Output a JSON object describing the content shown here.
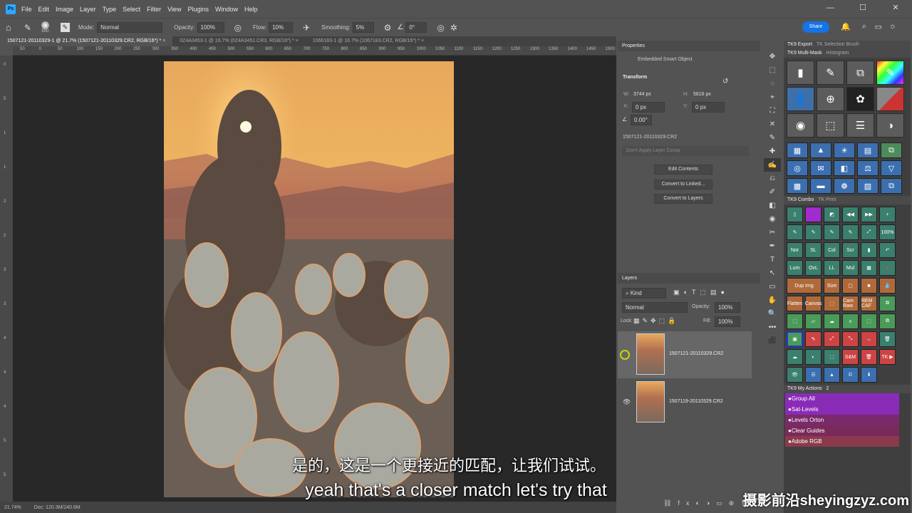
{
  "menu": {
    "logo": "Ps",
    "items": [
      "File",
      "Edit",
      "Image",
      "Layer",
      "Type",
      "Select",
      "Filter",
      "View",
      "Plugins",
      "Window",
      "Help"
    ]
  },
  "window_controls": [
    "—",
    "☐",
    "✕"
  ],
  "options": {
    "brush_size": "500",
    "mode_label": "Mode:",
    "mode_value": "Normal",
    "opacity_label": "Opacity:",
    "opacity_value": "100%",
    "flow_label": "Flow:",
    "flow_value": "10%",
    "smoothing_label": "Smoothing:",
    "smoothing_value": "5%",
    "angle_value": "0°",
    "share": "Share"
  },
  "tabs": [
    "1507121-20110329-1 @ 21.7% (1507121-20110329.CR2, RGB/16*) *",
    "0Z4A3453-1 @ 16.7% (0Z4A3451.CR3, RGB/16*) *",
    "1066183-1 @ 16.7% (1067183.CR2, RGB/16*) *"
  ],
  "ruler": {
    "top": [
      "50",
      "0",
      "50",
      "100",
      "150",
      "200",
      "250",
      "300",
      "350",
      "400",
      "450",
      "500",
      "550",
      "600",
      "650",
      "700",
      "750",
      "800",
      "850",
      "900",
      "950",
      "1000",
      "1050",
      "1100",
      "1150",
      "1200",
      "1250",
      "1300",
      "1350",
      "1400",
      "1450",
      "1500"
    ],
    "left": [
      "0",
      "5",
      "1",
      "1",
      "2",
      "2",
      "3",
      "3",
      "4",
      "4",
      "4",
      "5",
      "5"
    ]
  },
  "status": {
    "zoom": "21.74%",
    "doc": "Doc: 120.3M/240.6M"
  },
  "subtitles": {
    "cn": "是的，这是一个更接近的匹配，让我们试试。",
    "en": "yeah that's a closer match let's try that"
  },
  "watermark": "摄影前沿sheyingzyz.com",
  "properties": {
    "title": "Properties",
    "kind": "Embedded Smart Object",
    "transform": "Transform",
    "w_label": "W:",
    "w": "3744 px",
    "h_label": "H:",
    "h": "5616 px",
    "x_label": "X:",
    "x": "0 px",
    "y_label": "Y:",
    "y": "0 px",
    "angle": "0.00°",
    "file": "1507121-20110329.CR2",
    "comp": "Don't Apply Layer Comp",
    "buttons": [
      "Edit Contents",
      "Convert to Linked...",
      "Convert to Layers"
    ]
  },
  "layers": {
    "title": "Layers",
    "kind": "Kind",
    "blend": "Normal",
    "opacity_label": "Opacity:",
    "opacity": "100%",
    "lock_label": "Lock:",
    "fill_label": "Fill:",
    "fill": "100%",
    "items": [
      {
        "name": "1507121-20110329.CR2",
        "selected": true
      },
      {
        "name": "1507119-20110329.CR2",
        "selected": false
      }
    ]
  },
  "tools": [
    "✥",
    "⬚",
    "◌",
    "⌖",
    "⛶",
    "✕",
    "✎",
    "✚",
    "✍",
    "⎌",
    "✐",
    "◧",
    "◉",
    "✂",
    "✒",
    "T",
    "↖",
    "▭",
    "✋",
    "🔍",
    "•••",
    "⬛"
  ],
  "tk": {
    "tabs1": [
      "TK9 Export",
      "TK Selection Brush"
    ],
    "tabs2": [
      "TK9 Multi-Mask",
      "Histogram"
    ],
    "combo_tabs": [
      "TK9 Combo",
      "TK Print"
    ],
    "row_a": [
      "Nor",
      "SL",
      "Col",
      "Scr",
      "",
      "",
      "",
      ""
    ],
    "row_b": [
      "Lum",
      "OvL",
      "LL",
      "Mul"
    ],
    "row_c": [
      "Dup Img",
      "Size"
    ],
    "row_d": [
      "Flatten",
      "Canvas",
      "",
      "Cam Raw",
      "REM CAF"
    ],
    "pct": "100%",
    "sm": "S&M",
    "tk_btn": "TK ▶",
    "actions_title": "TK9 My Actions",
    "actions_count": "2",
    "actions": [
      "●Group All",
      "●Sat-Levels",
      "●Levels Orton",
      "●Clear Guides",
      "●Adobe RGB"
    ]
  }
}
